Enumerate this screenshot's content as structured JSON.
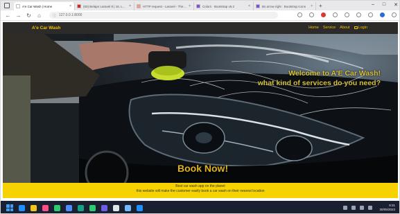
{
  "browser": {
    "tabs": [
      {
        "title": "A'e Car Wash | Home",
        "active": true,
        "favicon_color": "#ffffff"
      },
      {
        "title": "(60) Belajar Laravel 8 | 16. Lara...",
        "active": false,
        "favicon_color": "#e02020"
      },
      {
        "title": "HTTP request - Laravel - The PHP...",
        "active": false,
        "favicon_color": "#f29a8e"
      },
      {
        "title": "Colors · Bootstrap v5.2",
        "active": false,
        "favicon_color": "#7b51d6"
      },
      {
        "title": "Bs arrow right · Bootstrap Icons",
        "active": false,
        "favicon_color": "#7b51d6"
      }
    ],
    "url": "127.0.0.1:8000",
    "nav_icons": [
      "back-arrow-icon",
      "forward-arrow-icon",
      "reload-icon",
      "home-icon"
    ]
  },
  "site": {
    "brand": "A'e Car Wash",
    "nav_links": [
      "Home",
      "Service",
      "About",
      "Login"
    ],
    "hero": {
      "welcome_line1": "Welcome to A'E Car Wash!",
      "welcome_line2": "what kind of services do you need?",
      "book_now": "Book Now!"
    },
    "footer": {
      "line1": "Best car wash app on the planet",
      "line2": "this website will make the customer easily book a car wash on their nearest location"
    }
  },
  "taskbar": {
    "time": "9:31",
    "date": "30/05/2023",
    "app_colors": [
      "#1e90ff",
      "#f0c419",
      "#ff4d88",
      "#2ecc71",
      "#4f8cff",
      "#16a085",
      "#2ecc71",
      "#6c5ce7",
      "#dfe6e9",
      "#74b9ff",
      "#1e90ff"
    ]
  },
  "colors": {
    "accent_yellow": "#f6d200",
    "brand_text": "#f2c200",
    "navbar_bg": "#2c2b29"
  }
}
